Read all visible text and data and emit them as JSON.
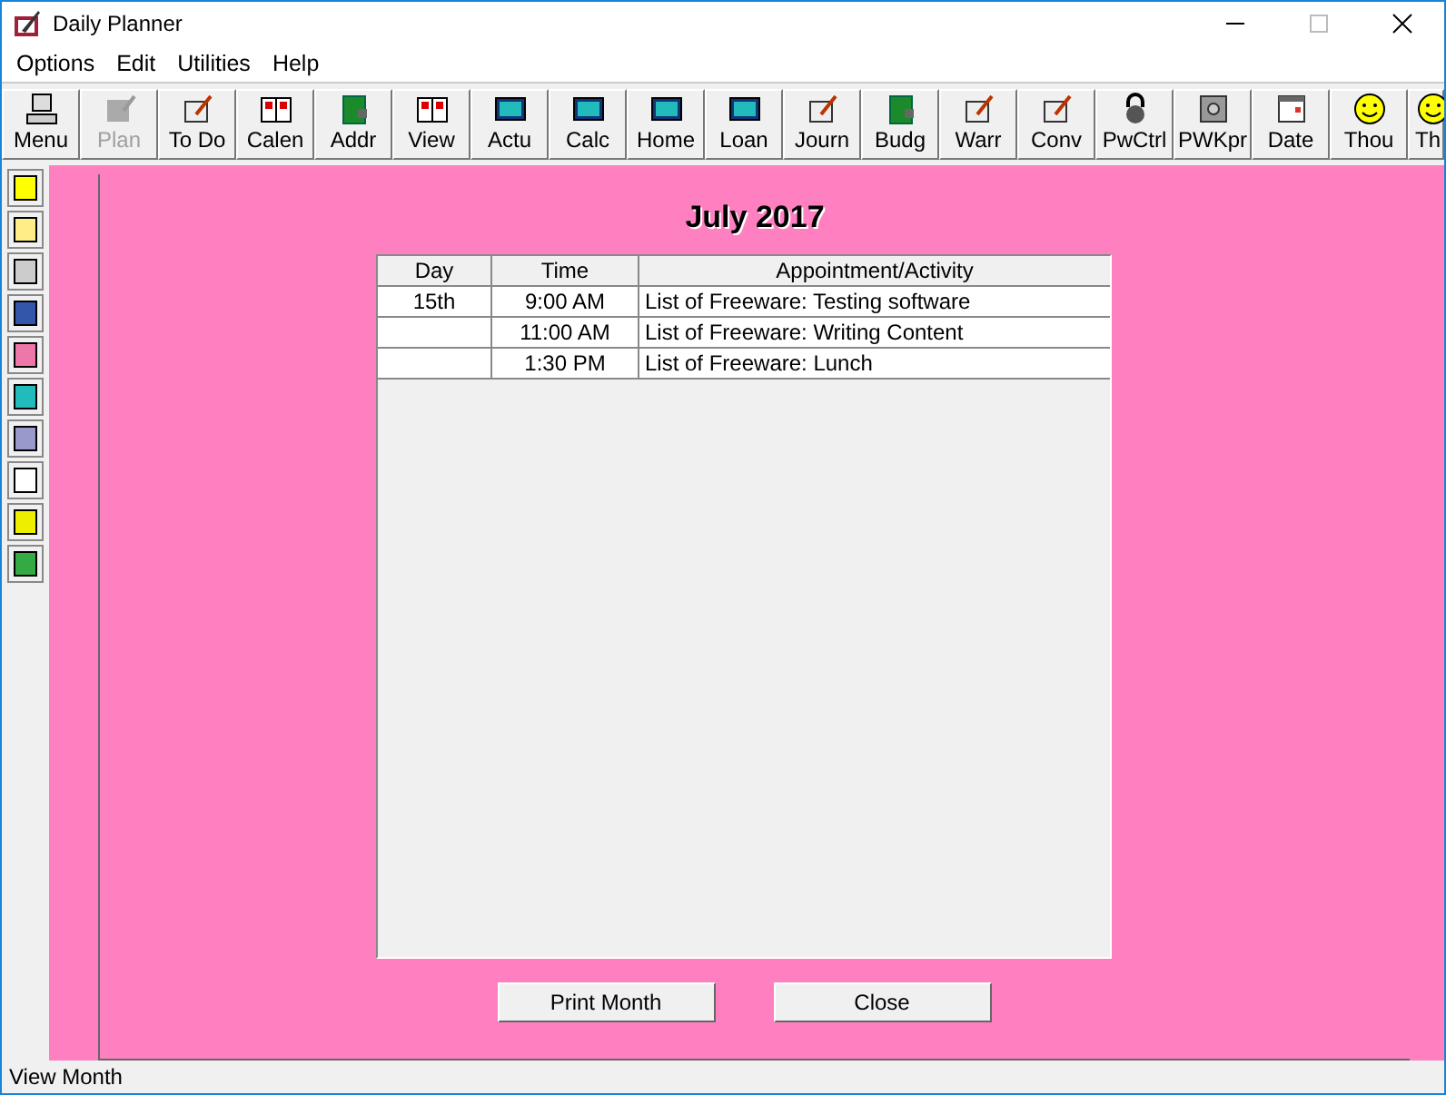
{
  "window": {
    "title": "Daily Planner"
  },
  "menu": [
    "Options",
    "Edit",
    "Utilities",
    "Help"
  ],
  "toolbar": [
    {
      "label": "Menu",
      "disabled": false
    },
    {
      "label": "Plan",
      "disabled": true
    },
    {
      "label": "To Do",
      "disabled": false
    },
    {
      "label": "Calen",
      "disabled": false
    },
    {
      "label": "Addr",
      "disabled": false
    },
    {
      "label": "View",
      "disabled": false
    },
    {
      "label": "Actu",
      "disabled": false
    },
    {
      "label": "Calc",
      "disabled": false
    },
    {
      "label": "Home",
      "disabled": false
    },
    {
      "label": "Loan",
      "disabled": false
    },
    {
      "label": "Journ",
      "disabled": false
    },
    {
      "label": "Budg",
      "disabled": false
    },
    {
      "label": "Warr",
      "disabled": false
    },
    {
      "label": "Conv",
      "disabled": false
    },
    {
      "label": "PwCtrl",
      "disabled": false
    },
    {
      "label": "PWKpr",
      "disabled": false
    },
    {
      "label": "Date",
      "disabled": false
    },
    {
      "label": "Thou",
      "disabled": false
    },
    {
      "label": "Th",
      "disabled": false
    }
  ],
  "panel": {
    "title": "July 2017",
    "table": {
      "columns": [
        "Day",
        "Time",
        "Appointment/Activity"
      ],
      "rows": [
        [
          "15th",
          "9:00 AM",
          "List of Freeware: Testing software"
        ],
        [
          "",
          "11:00 AM",
          "List of Freeware: Writing Content"
        ],
        [
          "",
          "1:30 PM",
          "List of Freeware: Lunch"
        ]
      ]
    },
    "buttons": [
      "Print Month",
      "Close"
    ]
  },
  "status_bar": "View Month"
}
